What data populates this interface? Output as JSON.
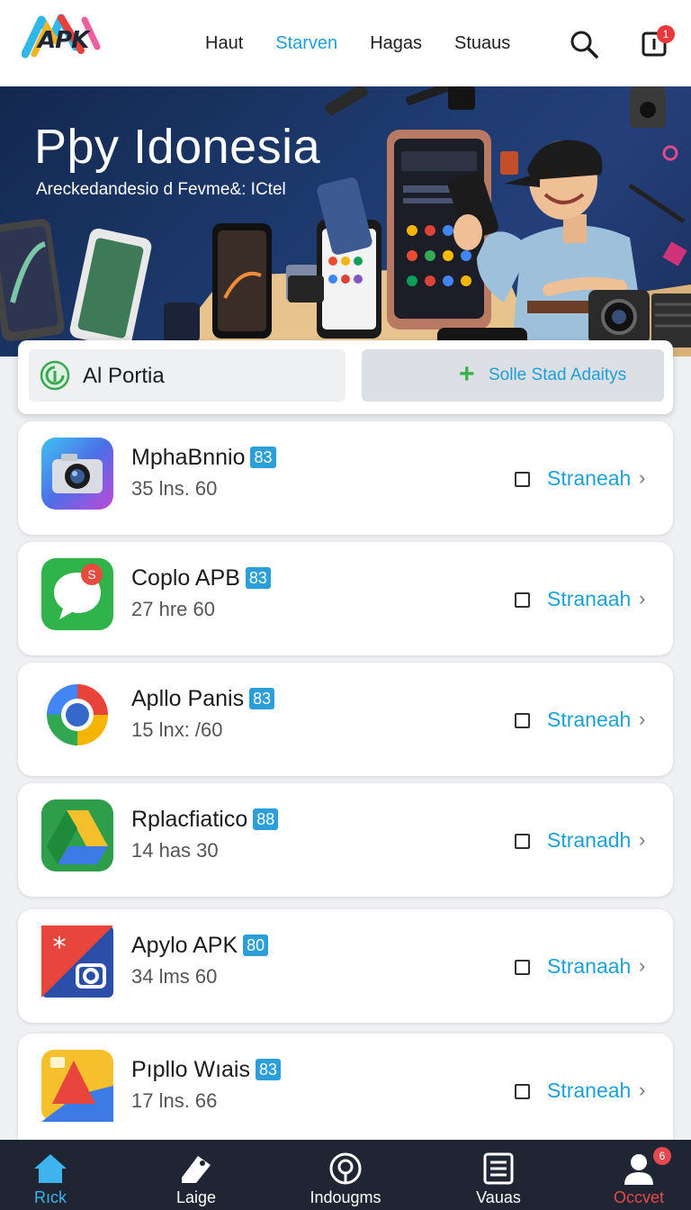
{
  "brand": {
    "logo_text": "APK"
  },
  "nav": {
    "links": [
      {
        "label": "Haut",
        "active": false
      },
      {
        "label": "Starven",
        "active": true
      },
      {
        "label": "Hagas",
        "active": false
      },
      {
        "label": "Stuaus",
        "active": false
      }
    ],
    "search_icon": "search-icon",
    "notification_icon": "notification-icon",
    "notification_count": "1"
  },
  "hero": {
    "title": "Pþy Idonesia",
    "subtitle": "Areckedandesio d Fevme&: ICtel"
  },
  "tabs": {
    "primary_label": "Al Portia",
    "secondary_label": "Solle Stad Adaitys"
  },
  "apps": [
    {
      "name": "MphaBnnio",
      "badge": "83",
      "meta": "35 lns. 60",
      "action": "Straneah",
      "icon": "camera-app-icon"
    },
    {
      "name": "Coplo APB",
      "badge": "83",
      "meta": "27 hre  60",
      "action": "Stranaah",
      "icon": "chat-app-icon"
    },
    {
      "name": "Apllo Panis",
      "badge": "83",
      "meta": "15 lnx: /60",
      "action": "Straneah",
      "icon": "browser-app-icon"
    },
    {
      "name": "Rplacfiatico",
      "badge": "88",
      "meta": "14 has  30",
      "action": "Stranadh",
      "icon": "drive-app-icon"
    },
    {
      "name": "Apylo APK",
      "badge": "80",
      "meta": "34 lms  60",
      "action": "Stranaah",
      "icon": "photo-app-icon"
    },
    {
      "name": "Pıpllo Wıais",
      "badge": "83",
      "meta": "17 lns. 66",
      "action": "Straneah",
      "icon": "slides-app-icon"
    }
  ],
  "bottom_nav": [
    {
      "label": "Rıck",
      "icon": "home-icon",
      "state": "active"
    },
    {
      "label": "Laige",
      "icon": "tag-icon",
      "state": "normal"
    },
    {
      "label": "Indougms",
      "icon": "target-icon",
      "state": "normal"
    },
    {
      "label": "Vauas",
      "icon": "list-icon",
      "state": "normal"
    },
    {
      "label": "Occvet",
      "icon": "profile-icon",
      "state": "alert",
      "badge": "6"
    }
  ],
  "colors": {
    "accent": "#1e9fd8",
    "hero_bg": "#1d3a6e",
    "bottom_bar": "#1f2532",
    "alert": "#e5484d",
    "plus_green": "#34b24a"
  }
}
